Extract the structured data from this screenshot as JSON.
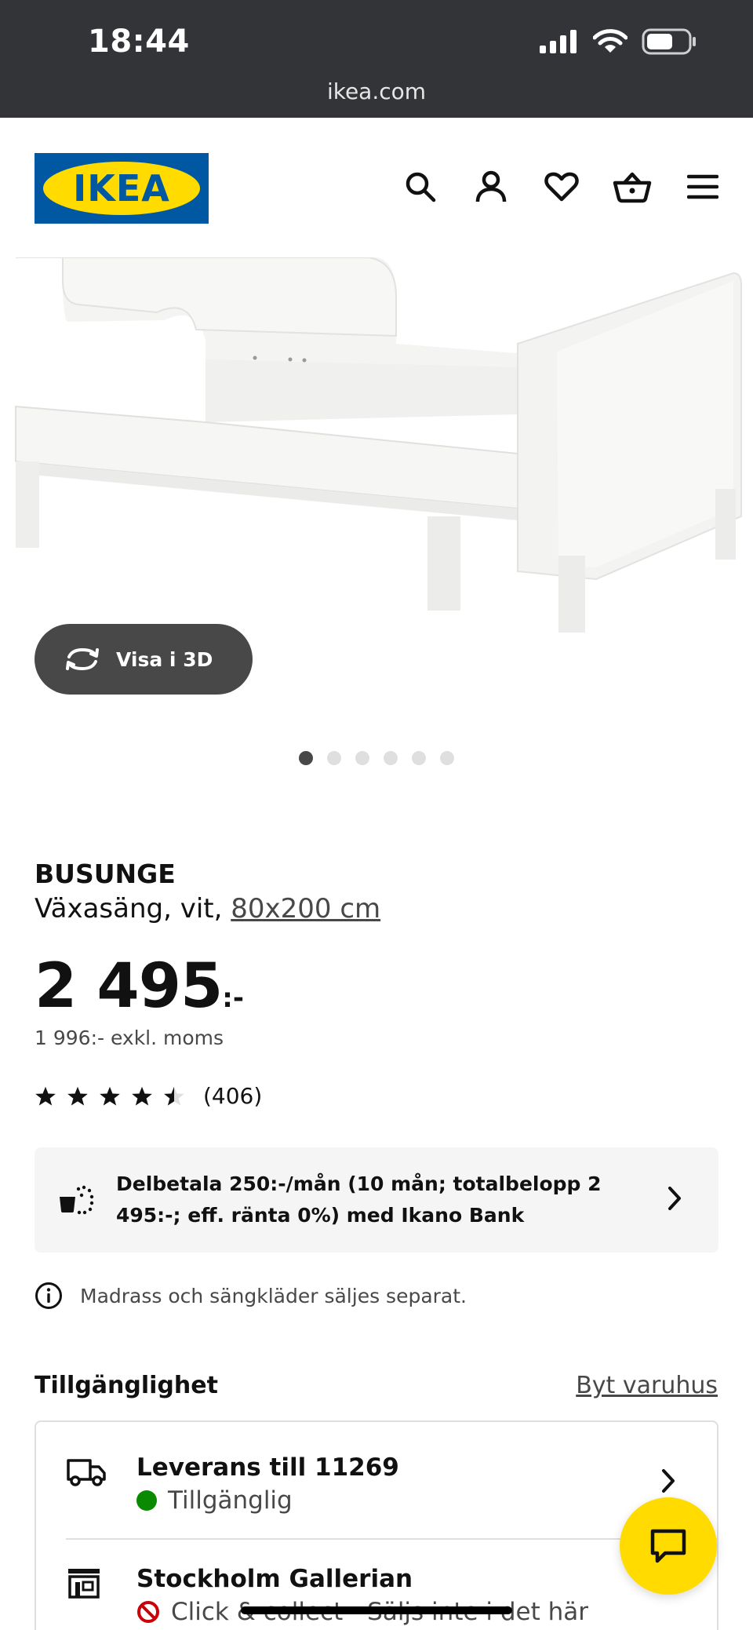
{
  "status_bar": {
    "time": "18:44",
    "url": "ikea.com"
  },
  "header": {
    "logo_text": "IKEA",
    "icons": [
      "search-icon",
      "account-icon",
      "heart-icon",
      "basket-icon",
      "menu-icon"
    ]
  },
  "gallery": {
    "view_3d_label": "Visa i 3D",
    "image_count": 6,
    "active_index": 0
  },
  "product": {
    "name": "BUSUNGE",
    "description": "Växasäng, vit,",
    "size": "80x200 cm",
    "price": "2 495",
    "price_suffix": ":-",
    "price_ex_vat": "1 996:- exkl. moms",
    "rating": 4.5,
    "rating_max": 5,
    "review_count": "(406)"
  },
  "financing": {
    "text": "Delbetala 250:-/mån (10 mån; totalbelopp 2 495:-; eff. ränta 0%) med Ikano Bank"
  },
  "note": "Madrass och sängkläder säljes separat.",
  "availability": {
    "title": "Tillgänglighet",
    "change_store": "Byt varuhus",
    "delivery": {
      "title": "Leverans till 11269",
      "status": "Tillgänglig"
    },
    "store": {
      "title": "Stockholm Gallerian",
      "status": "Click & collect - Säljs inte i det här"
    }
  },
  "colors": {
    "ikea_blue": "#0058a3",
    "ikea_yellow": "#ffdb00",
    "available_green": "#0a8a00",
    "unavailable_red": "#cc0008"
  }
}
